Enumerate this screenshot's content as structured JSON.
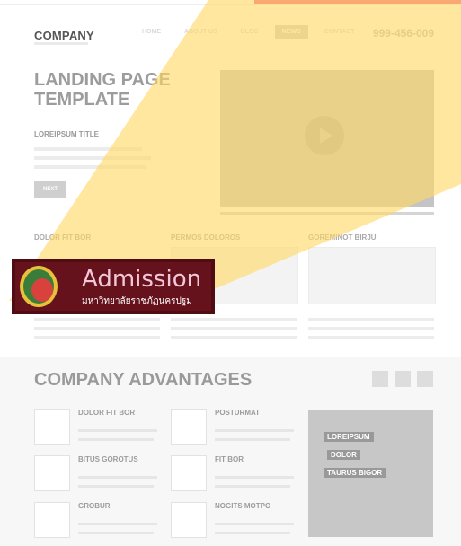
{
  "header": {
    "logo": "COMPANY",
    "nav": [
      {
        "label": "HOME",
        "active": false
      },
      {
        "label": "ABOUT US",
        "active": false
      },
      {
        "label": "BLOG",
        "active": false
      },
      {
        "label": "NEWS",
        "active": true
      },
      {
        "label": "CONTACT",
        "active": false
      }
    ],
    "phone": "999-456-009"
  },
  "hero": {
    "title_line1": "LANDING PAGE",
    "title_line2": "TEMPLATE",
    "subtitle": "LOREIPSUM TITLE",
    "button_label": "NEXT"
  },
  "columns": [
    {
      "title": "DOLOR FIT BOR"
    },
    {
      "title": "PERMOS DOLOROS"
    },
    {
      "title": "GOREMINOT BIRJU"
    }
  ],
  "advantages": {
    "title": "COMPANY ADVANTAGES",
    "features": [
      {
        "title": "DOLOR FIT BOR"
      },
      {
        "title": "POSTURMAT"
      },
      {
        "title": "BITUS GOROTUS"
      },
      {
        "title": "FIT BOR"
      },
      {
        "title": "GROBUR"
      },
      {
        "title": "NOGITS MOTPO"
      }
    ],
    "tags": [
      "LOREIPSUM",
      "DOLOR",
      "TAURUS BIGOR"
    ]
  },
  "overlay": {
    "word": "Admission",
    "subtitle": "มหาวิทยาลัยราชภัฏนครปฐม"
  },
  "colors": {
    "accent": "#ee5a86",
    "overlay_yellow": "#ffd966",
    "card_maroon": "#66121d"
  }
}
